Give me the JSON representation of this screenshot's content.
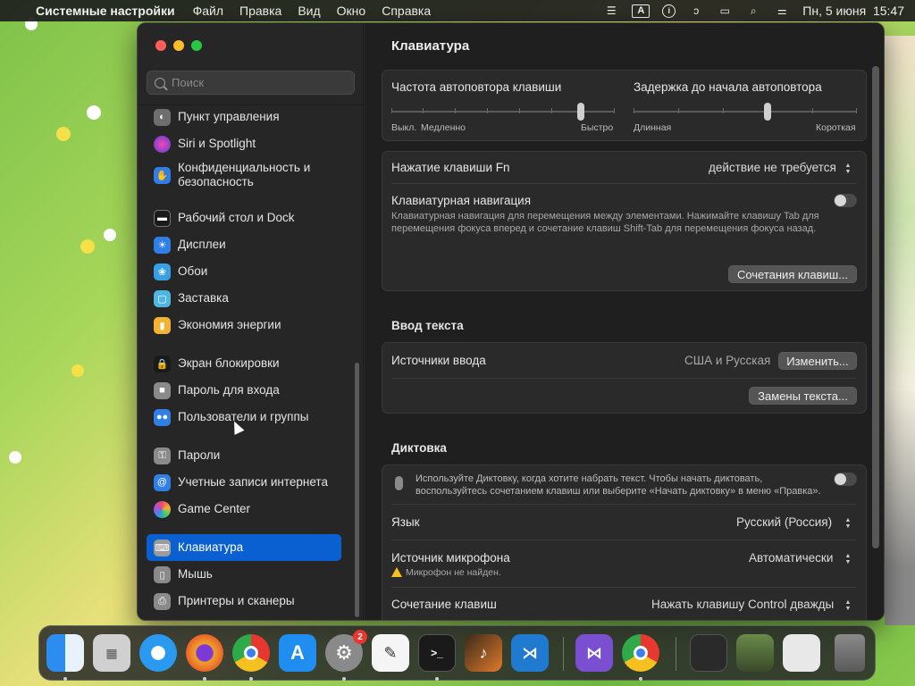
{
  "menubar": {
    "app_name": "Системные настройки",
    "menus": [
      "Файл",
      "Правка",
      "Вид",
      "Окно",
      "Справка"
    ],
    "input_source": "A",
    "datetime": "Пн, 5 июня  15:47"
  },
  "sidebar": {
    "search_placeholder": "Поиск",
    "items": [
      {
        "label": "Пункт управления",
        "icon": "control-center-icon",
        "color": "#6e6e6e"
      },
      {
        "label": "Siri и Spotlight",
        "icon": "siri-icon",
        "color": "#b04fd6"
      },
      {
        "label": "Конфиденциальность и безопасность",
        "icon": "hand-icon",
        "color": "#2f7fe6"
      },
      {
        "label": "Рабочий стол и Dock",
        "icon": "desktop-dock-icon",
        "color": "#3a3a3a"
      },
      {
        "label": "Дисплеи",
        "icon": "display-icon",
        "color": "#2f7fe6"
      },
      {
        "label": "Обои",
        "icon": "wallpaper-icon",
        "color": "#3aa0e6"
      },
      {
        "label": "Заставка",
        "icon": "screensaver-icon",
        "color": "#4fb6e6"
      },
      {
        "label": "Экономия энергии",
        "icon": "battery-icon",
        "color": "#f2b233"
      },
      {
        "label": "Экран блокировки",
        "icon": "lock-screen-icon",
        "color": "#2a2a2a"
      },
      {
        "label": "Пароль для входа",
        "icon": "lock-icon",
        "color": "#8a8a8a"
      },
      {
        "label": "Пользователи и группы",
        "icon": "users-icon",
        "color": "#2f7fe6"
      },
      {
        "label": "Пароли",
        "icon": "key-icon",
        "color": "#8a8a8a"
      },
      {
        "label": "Учетные записи интернета",
        "icon": "at-icon",
        "color": "#2f7fe6"
      },
      {
        "label": "Game Center",
        "icon": "game-center-icon",
        "color": "#e8e8e8"
      },
      {
        "label": "Клавиатура",
        "icon": "keyboard-icon",
        "color": "#8a8a8a"
      },
      {
        "label": "Мышь",
        "icon": "mouse-icon",
        "color": "#8a8a8a"
      },
      {
        "label": "Принтеры и сканеры",
        "icon": "printer-icon",
        "color": "#8a8a8a"
      }
    ]
  },
  "content": {
    "title": "Клавиатура",
    "repeat": {
      "label": "Частота автоповтора клавиши",
      "min": "Выкл.",
      "slow": "Медленно",
      "max": "Быстро",
      "value": 0.9
    },
    "delay": {
      "label": "Задержка до начала автоповтора",
      "min": "Длинная",
      "max": "Короткая",
      "value": 0.6
    },
    "fn_key": {
      "label": "Нажатие клавиши Fn",
      "value": "действие не требуется"
    },
    "kb_nav": {
      "label": "Клавиатурная навигация",
      "desc": "Клавиатурная навигация для перемещения между элементами. Нажимайте клавишу Tab для перемещения фокуса вперед и сочетание клавиш Shift-Tab для перемещения фокуса назад.",
      "enabled": false
    },
    "shortcuts_button": "Сочетания клавиш...",
    "text_input": {
      "section": "Ввод текста",
      "sources_label": "Источники ввода",
      "sources_value": "США и Русская",
      "edit_button": "Изменить...",
      "replacements_button": "Замены текста..."
    },
    "dictation": {
      "section": "Диктовка",
      "desc": "Используйте Диктовку, когда хотите набрать текст. Чтобы начать диктовать, воспользуйтесь сочетанием клавиш или выберите «Начать диктовку» в меню «Правка».",
      "enabled": false,
      "language_label": "Язык",
      "language_value": "Русский (Россия)",
      "mic_label": "Источник микрофона",
      "mic_value": "Автоматически",
      "mic_warning": "Микрофон не найден.",
      "shortcut_label": "Сочетание клавиш",
      "shortcut_value": "Нажать клавишу Control дважды"
    }
  },
  "dock": {
    "apps": [
      {
        "name": "finder-icon",
        "color": "#2d8cf0"
      },
      {
        "name": "launchpad-icon",
        "color": "#d0d0d0"
      },
      {
        "name": "safari-icon",
        "color": "#2a9af0"
      },
      {
        "name": "firefox-icon",
        "color": "#e8632a"
      },
      {
        "name": "chrome-icon",
        "color": "#f0f0f0"
      },
      {
        "name": "app-store-icon",
        "color": "#1f8ef0"
      },
      {
        "name": "system-settings-icon",
        "color": "#8a8a8a"
      },
      {
        "name": "textedit-icon",
        "color": "#f5f5f5"
      },
      {
        "name": "terminal-icon",
        "color": "#1a1a1a"
      },
      {
        "name": "garageband-icon",
        "color": "#e07a2a"
      },
      {
        "name": "vscode-icon",
        "color": "#1f7ad0"
      },
      {
        "name": "visual-studio-icon",
        "color": "#7a4fd0"
      },
      {
        "name": "chrome-icon",
        "color": "#f0f0f0"
      }
    ],
    "settings_badge": "2"
  }
}
